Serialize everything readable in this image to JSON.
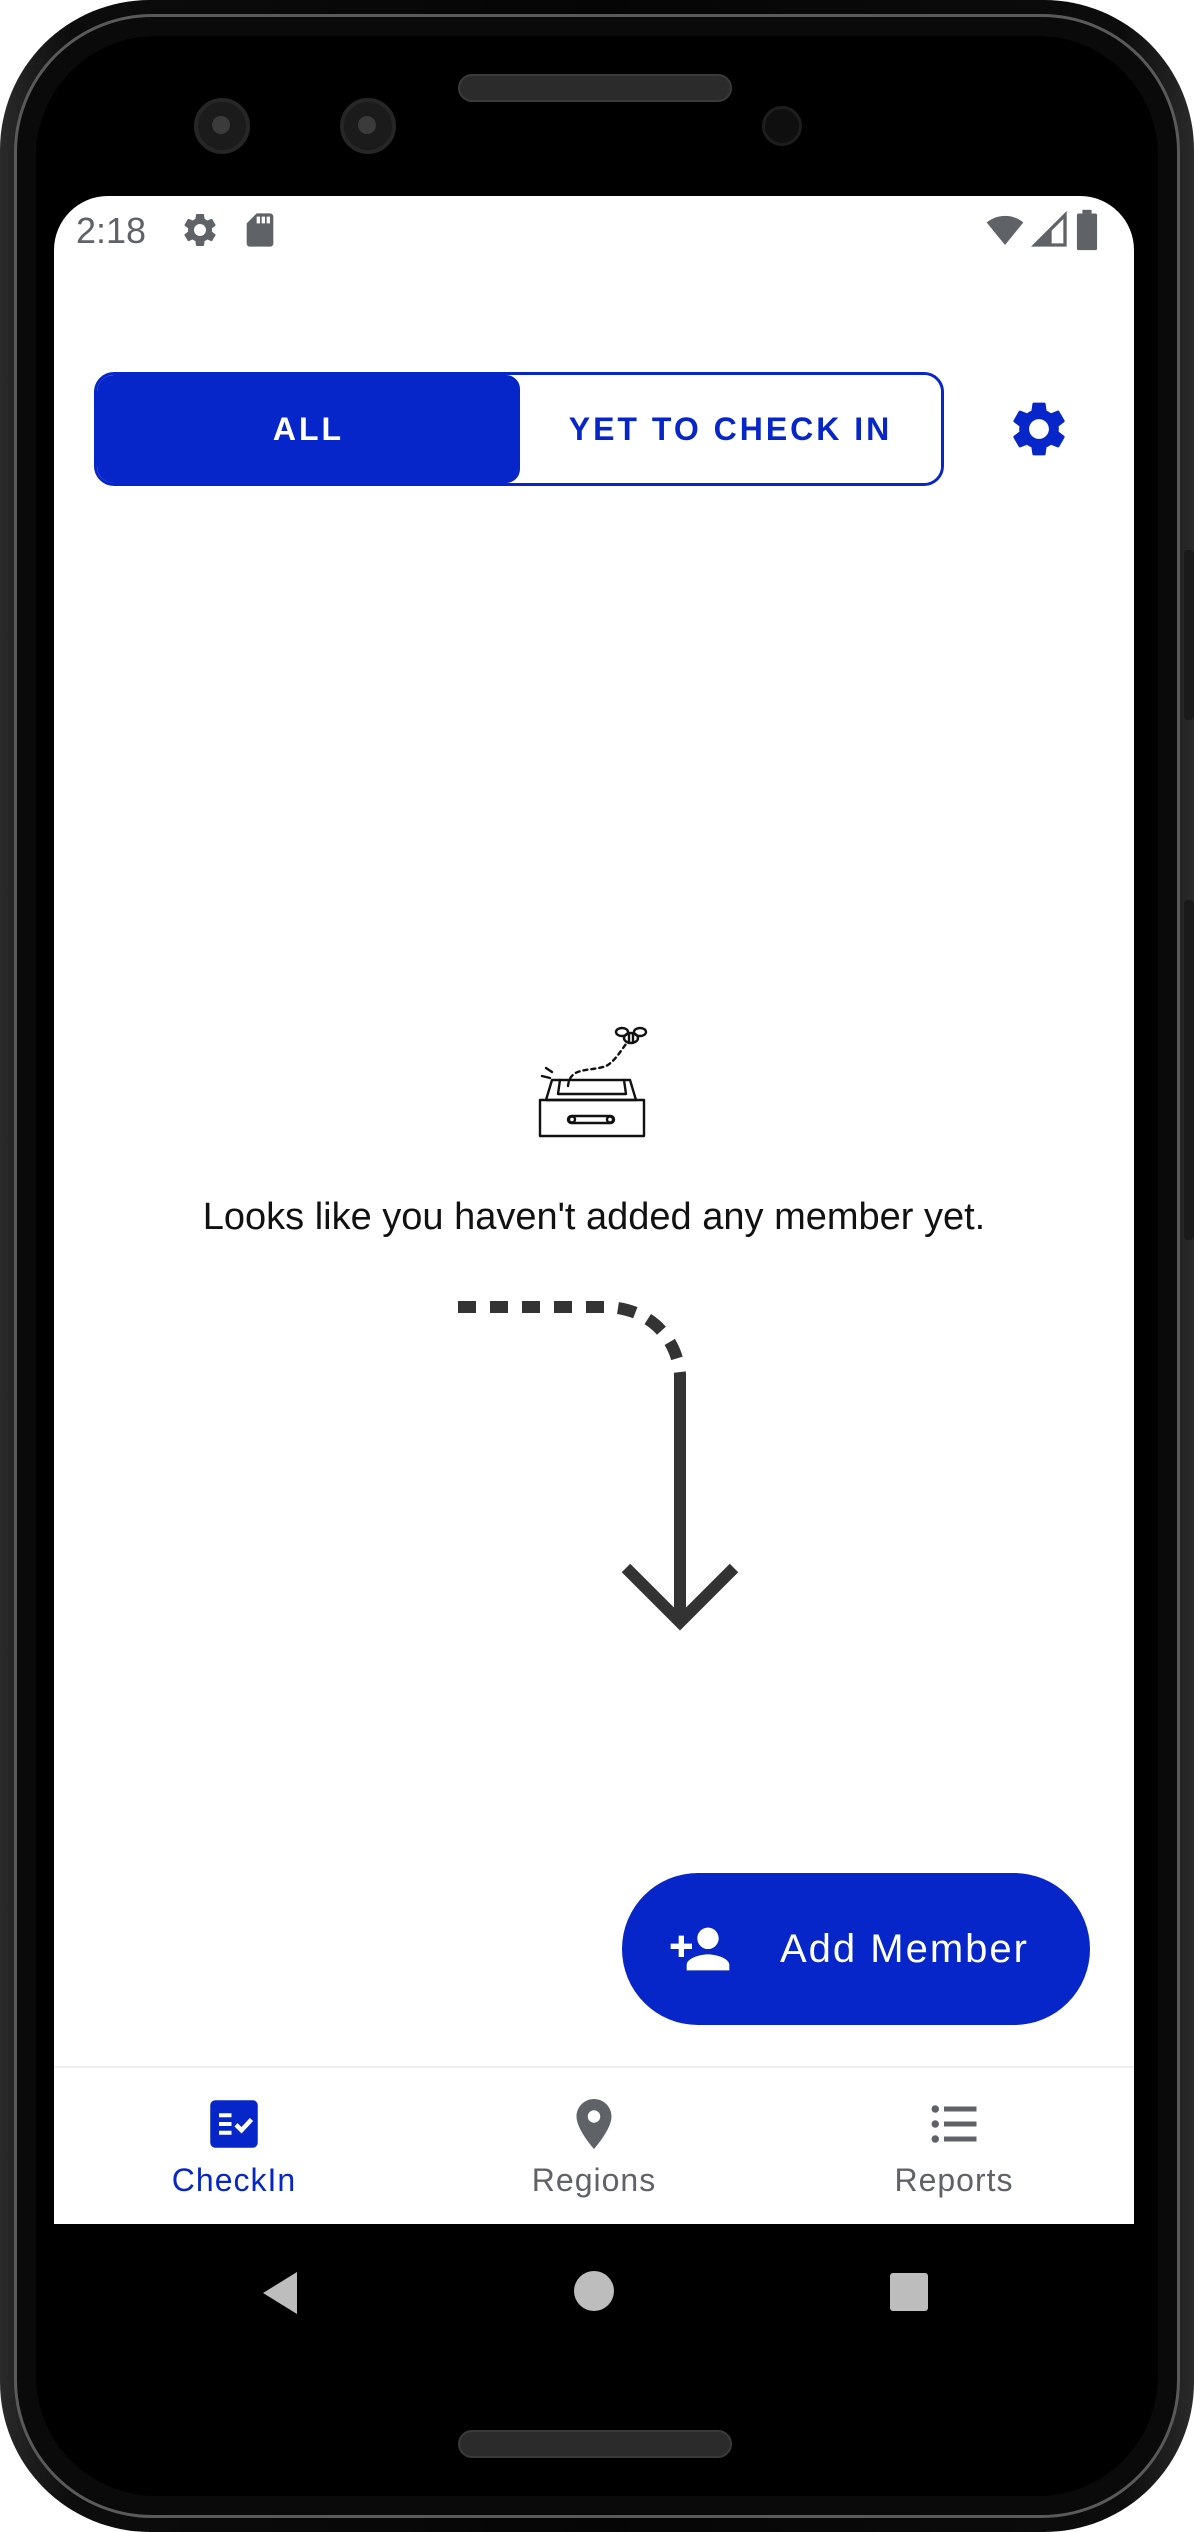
{
  "status_bar": {
    "time": "2:18",
    "left_icons": [
      "gear-icon",
      "sd-card-icon"
    ],
    "right_icons": [
      "wifi-icon",
      "cellular-signal-icon",
      "battery-icon"
    ]
  },
  "segmented_control": {
    "options": [
      {
        "label": "ALL",
        "selected": true
      },
      {
        "label": "YET TO CHECK IN",
        "selected": false
      }
    ]
  },
  "header": {
    "settings_icon": "gear-icon"
  },
  "empty_state": {
    "illustration": "empty-box-with-bee-icon",
    "message": "Looks like you haven't added any member yet.",
    "pointer": "dashed-curved-arrow-icon"
  },
  "fab": {
    "label": "Add Member",
    "icon": "add-person-icon"
  },
  "bottom_nav": {
    "items": [
      {
        "label": "CheckIn",
        "icon": "checklist-icon",
        "active": true
      },
      {
        "label": "Regions",
        "icon": "location-pin-icon",
        "active": false
      },
      {
        "label": "Reports",
        "icon": "list-icon",
        "active": false
      }
    ]
  },
  "system_nav": {
    "buttons": [
      "back-icon",
      "home-icon",
      "recents-icon"
    ]
  },
  "colors": {
    "primary": "#0626c9",
    "inactive_nav": "#5f6368",
    "text": "#111111",
    "status_icons": "#5f6368"
  }
}
